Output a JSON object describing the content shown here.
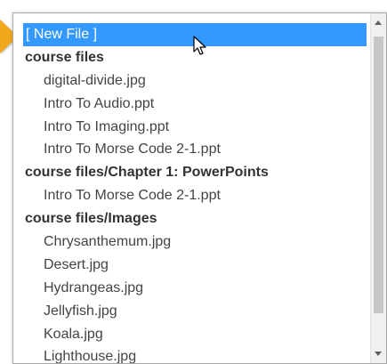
{
  "file_list": {
    "items": [
      {
        "label": "[ New File ]",
        "kind": "option",
        "selected": true
      },
      {
        "label": "course files",
        "kind": "group"
      },
      {
        "label": "digital-divide.jpg",
        "kind": "option"
      },
      {
        "label": "Intro To Audio.ppt",
        "kind": "option"
      },
      {
        "label": "Intro To Imaging.ppt",
        "kind": "option"
      },
      {
        "label": "Intro To Morse Code 2-1.ppt",
        "kind": "option"
      },
      {
        "label": "course files/Chapter 1: PowerPoints",
        "kind": "group"
      },
      {
        "label": "Intro To Morse Code 2-1.ppt",
        "kind": "option"
      },
      {
        "label": "course files/Images",
        "kind": "group"
      },
      {
        "label": "Chrysanthemum.jpg",
        "kind": "option"
      },
      {
        "label": "Desert.jpg",
        "kind": "option"
      },
      {
        "label": "Hydrangeas.jpg",
        "kind": "option"
      },
      {
        "label": "Jellyfish.jpg",
        "kind": "option"
      },
      {
        "label": "Koala.jpg",
        "kind": "option"
      },
      {
        "label": "Lighthouse.jpg",
        "kind": "option"
      }
    ]
  },
  "colors": {
    "selection": "#3399ff",
    "callout_arrow": "#f2a81d"
  },
  "icons": {
    "callout": "pointer-arrow-icon",
    "mouse": "mouse-cursor-icon"
  }
}
